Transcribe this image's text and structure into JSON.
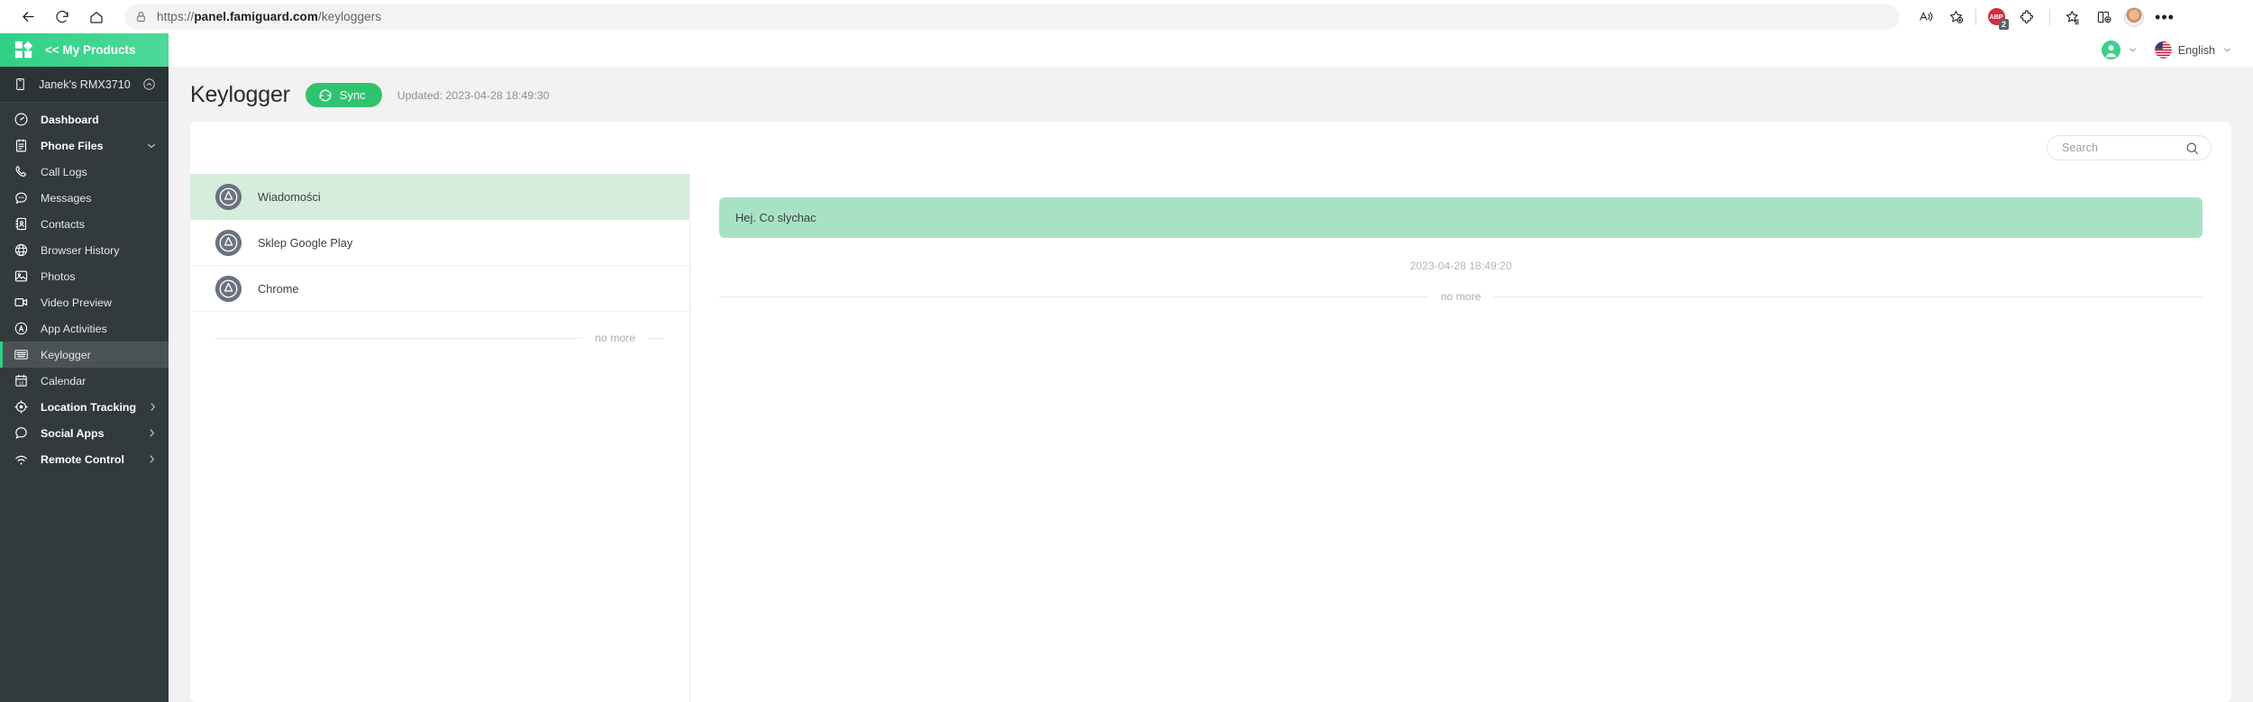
{
  "browser": {
    "url_prefix": "https://",
    "url_domain": "panel.famiguard.com",
    "url_path": "/keyloggers",
    "back_icon": "back-arrow-icon",
    "reload_icon": "reload-icon",
    "home_icon": "home-icon",
    "lock_icon": "lock-icon",
    "read_aloud_icon": "read-aloud-icon",
    "add_favorite_icon": "add-favorite-icon",
    "adblock_label": "ABP",
    "adblock_count": "2",
    "extensions_icon": "extensions-puzzle-icon",
    "collections_icon": "collections-icon",
    "split_screen_icon": "split-screen-icon",
    "profile_icon": "browser-profile-avatar",
    "settings_icon": "more-options-icon",
    "settings_label": "•••"
  },
  "sidebar": {
    "brand_label": "<< My Products",
    "brand_logo_icon": "famiguard-logo-icon",
    "device": {
      "label": "Janek's RMX3710",
      "icon": "phone-icon",
      "caret_icon": "chevron-up-circle-icon"
    },
    "items": [
      {
        "label": "Dashboard",
        "icon": "dashboard-gauge-icon",
        "bold": true,
        "active": false,
        "caret": ""
      },
      {
        "label": "Phone Files",
        "icon": "phone-files-icon",
        "bold": true,
        "active": false,
        "caret": "chevron-down-icon"
      },
      {
        "label": "Call Logs",
        "icon": "phone-call-icon",
        "bold": false,
        "active": false,
        "caret": ""
      },
      {
        "label": "Messages",
        "icon": "messages-bubble-icon",
        "bold": false,
        "active": false,
        "caret": ""
      },
      {
        "label": "Contacts",
        "icon": "contacts-book-icon",
        "bold": false,
        "active": false,
        "caret": ""
      },
      {
        "label": "Browser History",
        "icon": "globe-icon",
        "bold": false,
        "active": false,
        "caret": ""
      },
      {
        "label": "Photos",
        "icon": "photo-icon",
        "bold": false,
        "active": false,
        "caret": ""
      },
      {
        "label": "Video Preview",
        "icon": "video-camera-icon",
        "bold": false,
        "active": false,
        "caret": ""
      },
      {
        "label": "App Activities",
        "icon": "app-activities-icon",
        "bold": false,
        "active": false,
        "caret": ""
      },
      {
        "label": "Keylogger",
        "icon": "keyboard-icon",
        "bold": false,
        "active": true,
        "caret": ""
      },
      {
        "label": "Calendar",
        "icon": "calendar-icon",
        "bold": false,
        "active": false,
        "caret": ""
      },
      {
        "label": "Location Tracking",
        "icon": "location-target-icon",
        "bold": true,
        "active": false,
        "caret": "chevron-right-icon"
      },
      {
        "label": "Social Apps",
        "icon": "chat-bubble-icon",
        "bold": true,
        "active": false,
        "caret": "chevron-right-icon"
      },
      {
        "label": "Remote Control",
        "icon": "remote-control-icon",
        "bold": true,
        "active": false,
        "caret": "chevron-right-icon"
      }
    ]
  },
  "topbar": {
    "account_icon": "user-avatar-icon",
    "account_caret_icon": "chevron-down-icon",
    "flag_icon": "us-flag-icon",
    "language_label": "English",
    "language_caret_icon": "chevron-down-icon"
  },
  "page": {
    "title": "Keylogger",
    "sync_label": "Sync",
    "sync_icon": "sync-refresh-icon",
    "updated_label": "Updated: 2023-04-28 18:49:30"
  },
  "search": {
    "placeholder": "Search",
    "value": "",
    "icon": "search-icon"
  },
  "app_list": {
    "items": [
      {
        "name": "Wiadomości",
        "icon": "app-store-icon",
        "selected": true
      },
      {
        "name": "Sklep Google Play",
        "icon": "app-store-icon",
        "selected": false
      },
      {
        "name": "Chrome",
        "icon": "app-store-icon",
        "selected": false
      }
    ],
    "no_more_label": "no more"
  },
  "thread": {
    "messages": [
      {
        "text": "Hej. Co slychac",
        "time": "2023-04-28 18:49:20"
      }
    ],
    "no_more_label": "no more"
  },
  "colors": {
    "brand_green": "#2fd086",
    "sync_green": "#2ec46f",
    "bubble_green": "#a8e2c4",
    "row_selected": "#d6ecdd",
    "sidebar_bg": "#323a3e",
    "sidebar_active": "#4a5256"
  }
}
